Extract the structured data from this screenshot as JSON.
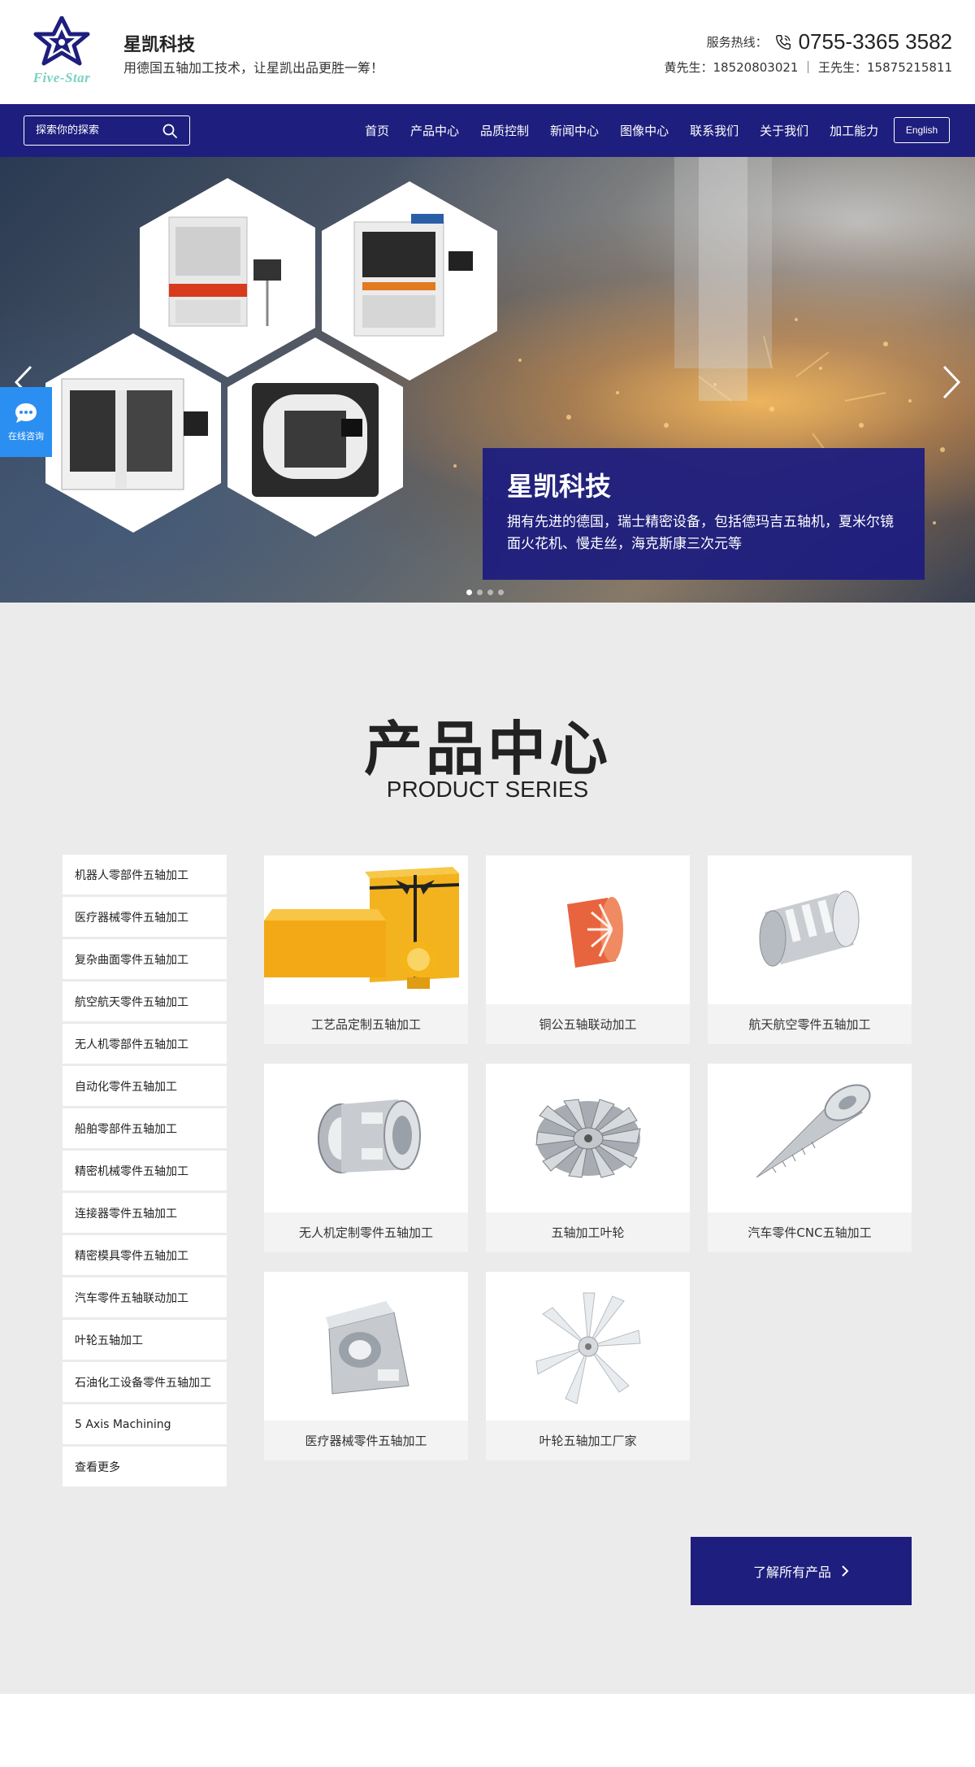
{
  "header": {
    "brand_name": "星凯科技",
    "slogan": "用德国五轴加工技术，让星凯出品更胜一筹！",
    "logo_text": "Five-Star",
    "hotline_label": "服务热线：",
    "hotline_number": "0755-3365 3582",
    "contacts": "黄先生：18520803021 ｜ 王先生：15875215811",
    "brand_color": "#1e1e7e"
  },
  "nav": {
    "search_placeholder": "探索你的探索",
    "items": [
      "首页",
      "产品中心",
      "品质控制",
      "新闻中心",
      "图像中心",
      "联系我们",
      "关于我们",
      "加工能力"
    ],
    "lang_button": "English"
  },
  "banner": {
    "card_title": "星凯科技",
    "card_text": "拥有先进的德国，瑞士精密设备，包括德玛吉五轴机，夏米尔镜面火花机、慢走丝，海克斯康三次元等",
    "slide_count": 4,
    "active_slide": 1
  },
  "chat": {
    "label": "在线咨询"
  },
  "products_section": {
    "title": "产品中心",
    "subtitle": "PRODUCT SERIES",
    "categories": [
      "机器人零部件五轴加工",
      "医疗器械零件五轴加工",
      "复杂曲面零件五轴加工",
      "航空航天零件五轴加工",
      "无人机零部件五轴加工",
      "自动化零件五轴加工",
      "船舶零部件五轴加工",
      "精密机械零件五轴加工",
      "连接器零件五轴加工",
      "精密模具零件五轴加工",
      "汽车零件五轴联动加工",
      "叶轮五轴加工",
      "石油化工设备零件五轴加工",
      "5 Axis Machining",
      "查看更多"
    ],
    "products": [
      "工艺品定制五轴加工",
      "铜公五轴联动加工",
      "航天航空零件五轴加工",
      "无人机定制零件五轴加工",
      "五轴加工叶轮",
      "汽车零件CNC五轴加工",
      "医疗器械零件五轴加工",
      "叶轮五轴加工厂家"
    ],
    "more_button": "了解所有产品"
  }
}
